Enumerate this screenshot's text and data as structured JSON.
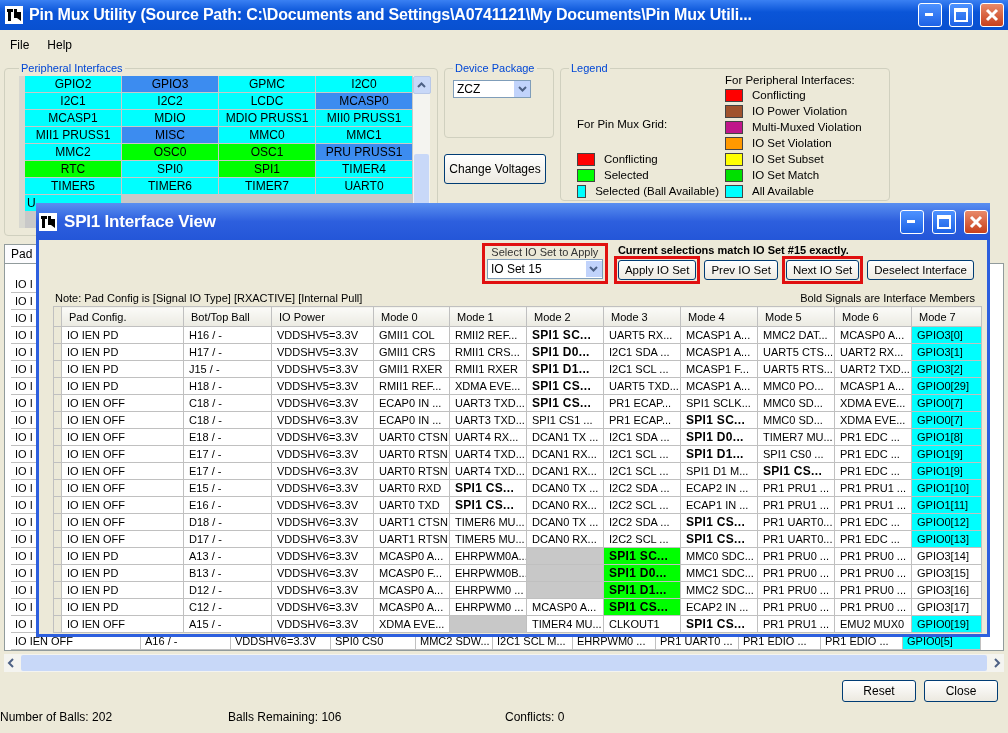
{
  "window": {
    "title": "Pin Mux Utility (Source Path: C:\\Documents and Settings\\A0741121\\My Documents\\Pin Mux Utili..."
  },
  "menu": [
    "File",
    "Help"
  ],
  "peripheral_interfaces": {
    "title": "Peripheral Interfaces",
    "rows": [
      [
        {
          "label": "GPIO2",
          "color": "#00ffff"
        },
        {
          "label": "GPIO3",
          "color": "#3c8cf0"
        },
        {
          "label": "GPMC",
          "color": "#00ffff"
        },
        {
          "label": "I2C0",
          "color": "#00ffff"
        }
      ],
      [
        {
          "label": "I2C1",
          "color": "#00ffff"
        },
        {
          "label": "I2C2",
          "color": "#00ffff"
        },
        {
          "label": "LCDC",
          "color": "#00ffff"
        },
        {
          "label": "MCASP0",
          "color": "#3c8cf0"
        }
      ],
      [
        {
          "label": "MCASP1",
          "color": "#00ffff"
        },
        {
          "label": "MDIO",
          "color": "#00ffff"
        },
        {
          "label": "MDIO PRUSS1",
          "color": "#00ffff"
        },
        {
          "label": "MII0 PRUSS1",
          "color": "#00ffff"
        }
      ],
      [
        {
          "label": "MII1 PRUSS1",
          "color": "#00ffff"
        },
        {
          "label": "MISC",
          "color": "#3c8cf0"
        },
        {
          "label": "MMC0",
          "color": "#00ffff"
        },
        {
          "label": "MMC1",
          "color": "#00ffff"
        }
      ],
      [
        {
          "label": "MMC2",
          "color": "#00ffff"
        },
        {
          "label": "OSC0",
          "color": "#00ff00"
        },
        {
          "label": "OSC1",
          "color": "#00ff00"
        },
        {
          "label": "PRU PRUSS1",
          "color": "#3c8cf0"
        }
      ],
      [
        {
          "label": "RTC",
          "color": "#00ff00"
        },
        {
          "label": "SPI0",
          "color": "#00ffff"
        },
        {
          "label": "SPI1",
          "color": "#00ff00"
        },
        {
          "label": "TIMER4",
          "color": "#00ffff"
        }
      ],
      [
        {
          "label": "TIMER5",
          "color": "#00ffff"
        },
        {
          "label": "TIMER6",
          "color": "#00ffff"
        },
        {
          "label": "TIMER7",
          "color": "#00ffff"
        },
        {
          "label": "UART0",
          "color": "#00ffff"
        }
      ],
      [
        {
          "label": "U",
          "color": "#00ffff"
        }
      ]
    ]
  },
  "device_package": {
    "title": "Device Package",
    "value": "ZCZ"
  },
  "change_voltages_button": "Change Voltages",
  "legend": {
    "title": "Legend",
    "grid_heading": "For Pin Mux Grid:",
    "grid_items": [
      {
        "label": "Conflicting",
        "color": "#ff0000"
      },
      {
        "label": "Selected",
        "color": "#00ff00"
      },
      {
        "label": "Selected (Ball Available)",
        "color": "#00ffff"
      }
    ],
    "peripheral_heading": "For Peripheral Interfaces:",
    "peripheral_items": [
      {
        "label": "Conflicting",
        "color": "#ff0000"
      },
      {
        "label": "IO Power Violation",
        "color": "#a0522d"
      },
      {
        "label": "Multi-Muxed Violation",
        "color": "#c0168a"
      },
      {
        "label": "IO Set Violation",
        "color": "#ff9900"
      },
      {
        "label": "IO Set Subset",
        "color": "#ffff00"
      },
      {
        "label": "IO Set Match",
        "color": "#00e000"
      },
      {
        "label": "All Available",
        "color": "#00ffff"
      }
    ]
  },
  "background_table": {
    "tab": "Pad",
    "rows": [
      "IO I",
      "IO I",
      "IO I",
      "IO I",
      "IO I",
      "IO I",
      "IO I",
      "IO I",
      "IO I",
      "IO I",
      "IO I",
      "IO I",
      "IO I",
      "IO I",
      "IO I",
      "IO I",
      "IO I",
      "IO I",
      "IO I",
      "IO I",
      "IO I"
    ],
    "last_row": [
      {
        "text": "IO IEN OFF",
        "kind": "plain"
      },
      {
        "text": "A16 / -",
        "kind": "plain"
      },
      {
        "text": "VDDSHV6=3.3V",
        "kind": "plain"
      },
      {
        "text": "SPI0 CS0",
        "kind": "plain"
      },
      {
        "text": "MMC2 SDW...",
        "kind": "plain"
      },
      {
        "text": "I2C1 SCL M...",
        "kind": "plain"
      },
      {
        "text": "EHRPWM0 ...",
        "kind": "plain"
      },
      {
        "text": "PR1 UART0 ...",
        "kind": "plain"
      },
      {
        "text": "PR1 EDIO ...",
        "kind": "plain"
      },
      {
        "text": "PR1 EDIO ...",
        "kind": "plain"
      },
      {
        "text": "GPIO0[5]",
        "kind": "available"
      }
    ]
  },
  "dialog": {
    "title": "SPI1 Interface View",
    "io_set_label": "Select IO Set to Apply",
    "io_set": {
      "value": "IO Set 15",
      "annotated": true
    },
    "message": "Current selections match IO Set #15 exactly.",
    "buttons": [
      {
        "label": "Apply IO Set",
        "annotated": true
      },
      {
        "label": "Prev IO Set",
        "annotated": false
      },
      {
        "label": "Next IO Set",
        "annotated": true
      },
      {
        "label": "Deselect Interface",
        "annotated": false
      }
    ],
    "note": "Note: Pad Config is [Signal IO Type] [RXACTIVE] [Internal Pull]",
    "bold_note": "Bold Signals are Interface Members",
    "columns": [
      "Pad Config.",
      "Bot/Top Ball",
      "IO Power",
      "Mode 0",
      "Mode 1",
      "Mode 2",
      "Mode 3",
      "Mode 4",
      "Mode 5",
      "Mode 6",
      "Mode 7"
    ],
    "rows": [
      {
        "pad": "IO IEN PD",
        "ball": "H16 / -",
        "power": "VDDSHV5=3.3V",
        "modes": [
          {
            "text": "GMII1 COL",
            "bold": false,
            "kind": "plain"
          },
          {
            "text": "RMII2 REF...",
            "bold": false,
            "kind": "plain"
          },
          {
            "text": "SPI1 SC...",
            "bold": true,
            "kind": "plain"
          },
          {
            "text": "UART5 RX...",
            "bold": false,
            "kind": "plain"
          },
          {
            "text": "MCASP1 A...",
            "bold": false,
            "kind": "plain"
          },
          {
            "text": "MMC2 DAT...",
            "bold": false,
            "kind": "plain"
          },
          {
            "text": "MCASP0 A...",
            "bold": false,
            "kind": "plain"
          },
          {
            "text": "GPIO3[0]",
            "bold": false,
            "kind": "available"
          }
        ]
      },
      {
        "pad": "IO IEN PD",
        "ball": "H17 / -",
        "power": "VDDSHV5=3.3V",
        "modes": [
          {
            "text": "GMII1 CRS",
            "bold": false,
            "kind": "plain"
          },
          {
            "text": "RMII1 CRS...",
            "bold": false,
            "kind": "plain"
          },
          {
            "text": "SPI1 D0...",
            "bold": true,
            "kind": "plain"
          },
          {
            "text": "I2C1 SDA ...",
            "bold": false,
            "kind": "plain"
          },
          {
            "text": "MCASP1 A...",
            "bold": false,
            "kind": "plain"
          },
          {
            "text": "UART5 CTS...",
            "bold": false,
            "kind": "plain"
          },
          {
            "text": "UART2 RX...",
            "bold": false,
            "kind": "plain"
          },
          {
            "text": "GPIO3[1]",
            "bold": false,
            "kind": "available"
          }
        ]
      },
      {
        "pad": "IO IEN PD",
        "ball": "J15 / -",
        "power": "VDDSHV5=3.3V",
        "modes": [
          {
            "text": "GMII1 RXER",
            "bold": false,
            "kind": "plain"
          },
          {
            "text": "RMII1 RXER",
            "bold": false,
            "kind": "plain"
          },
          {
            "text": "SPI1 D1...",
            "bold": true,
            "kind": "plain"
          },
          {
            "text": "I2C1 SCL ...",
            "bold": false,
            "kind": "plain"
          },
          {
            "text": "MCASP1 F...",
            "bold": false,
            "kind": "plain"
          },
          {
            "text": "UART5 RTS...",
            "bold": false,
            "kind": "plain"
          },
          {
            "text": "UART2 TXD...",
            "bold": false,
            "kind": "plain"
          },
          {
            "text": "GPIO3[2]",
            "bold": false,
            "kind": "available"
          }
        ]
      },
      {
        "pad": "IO IEN PD",
        "ball": "H18 / -",
        "power": "VDDSHV5=3.3V",
        "modes": [
          {
            "text": "RMII1 REF...",
            "bold": false,
            "kind": "plain"
          },
          {
            "text": "XDMA EVE...",
            "bold": false,
            "kind": "plain"
          },
          {
            "text": "SPI1 CS...",
            "bold": true,
            "kind": "plain"
          },
          {
            "text": "UART5 TXD...",
            "bold": false,
            "kind": "plain"
          },
          {
            "text": "MCASP1 A...",
            "bold": false,
            "kind": "plain"
          },
          {
            "text": "MMC0 PO...",
            "bold": false,
            "kind": "plain"
          },
          {
            "text": "MCASP1 A...",
            "bold": false,
            "kind": "plain"
          },
          {
            "text": "GPIO0[29]",
            "bold": false,
            "kind": "available"
          }
        ]
      },
      {
        "pad": "IO IEN OFF",
        "ball": "C18 / -",
        "power": "VDDSHV6=3.3V",
        "modes": [
          {
            "text": "ECAP0 IN ...",
            "bold": false,
            "kind": "plain"
          },
          {
            "text": "UART3 TXD...",
            "bold": false,
            "kind": "plain"
          },
          {
            "text": "SPI1 CS...",
            "bold": true,
            "kind": "plain"
          },
          {
            "text": "PR1 ECAP...",
            "bold": false,
            "kind": "plain"
          },
          {
            "text": "SPI1 SCLK...",
            "bold": false,
            "kind": "plain"
          },
          {
            "text": "MMC0 SD...",
            "bold": false,
            "kind": "plain"
          },
          {
            "text": "XDMA EVE...",
            "bold": false,
            "kind": "plain"
          },
          {
            "text": "GPIO0[7]",
            "bold": false,
            "kind": "available"
          }
        ]
      },
      {
        "pad": "IO IEN OFF",
        "ball": "C18 / -",
        "power": "VDDSHV6=3.3V",
        "modes": [
          {
            "text": "ECAP0 IN ...",
            "bold": false,
            "kind": "plain"
          },
          {
            "text": "UART3 TXD...",
            "bold": false,
            "kind": "plain"
          },
          {
            "text": "SPI1 CS1 ...",
            "bold": false,
            "kind": "plain"
          },
          {
            "text": "PR1 ECAP...",
            "bold": false,
            "kind": "plain"
          },
          {
            "text": "SPI1 SC...",
            "bold": true,
            "kind": "plain"
          },
          {
            "text": "MMC0 SD...",
            "bold": false,
            "kind": "plain"
          },
          {
            "text": "XDMA EVE...",
            "bold": false,
            "kind": "plain"
          },
          {
            "text": "GPIO0[7]",
            "bold": false,
            "kind": "available"
          }
        ]
      },
      {
        "pad": "IO IEN OFF",
        "ball": "E18 / -",
        "power": "VDDSHV6=3.3V",
        "modes": [
          {
            "text": "UART0 CTSN",
            "bold": false,
            "kind": "plain"
          },
          {
            "text": "UART4 RX...",
            "bold": false,
            "kind": "plain"
          },
          {
            "text": "DCAN1 TX ...",
            "bold": false,
            "kind": "plain"
          },
          {
            "text": "I2C1 SDA ...",
            "bold": false,
            "kind": "plain"
          },
          {
            "text": "SPI1 D0...",
            "bold": true,
            "kind": "plain"
          },
          {
            "text": "TIMER7 MU...",
            "bold": false,
            "kind": "plain"
          },
          {
            "text": "PR1 EDC ...",
            "bold": false,
            "kind": "plain"
          },
          {
            "text": "GPIO1[8]",
            "bold": false,
            "kind": "available"
          }
        ]
      },
      {
        "pad": "IO IEN OFF",
        "ball": "E17 / -",
        "power": "VDDSHV6=3.3V",
        "modes": [
          {
            "text": "UART0 RTSN",
            "bold": false,
            "kind": "plain"
          },
          {
            "text": "UART4 TXD...",
            "bold": false,
            "kind": "plain"
          },
          {
            "text": "DCAN1 RX...",
            "bold": false,
            "kind": "plain"
          },
          {
            "text": "I2C1 SCL ...",
            "bold": false,
            "kind": "plain"
          },
          {
            "text": "SPI1 D1...",
            "bold": true,
            "kind": "plain"
          },
          {
            "text": "SPI1 CS0 ...",
            "bold": false,
            "kind": "plain"
          },
          {
            "text": "PR1 EDC ...",
            "bold": false,
            "kind": "plain"
          },
          {
            "text": "GPIO1[9]",
            "bold": false,
            "kind": "available"
          }
        ]
      },
      {
        "pad": "IO IEN OFF",
        "ball": "E17 / -",
        "power": "VDDSHV6=3.3V",
        "modes": [
          {
            "text": "UART0 RTSN",
            "bold": false,
            "kind": "plain"
          },
          {
            "text": "UART4 TXD...",
            "bold": false,
            "kind": "plain"
          },
          {
            "text": "DCAN1 RX...",
            "bold": false,
            "kind": "plain"
          },
          {
            "text": "I2C1 SCL ...",
            "bold": false,
            "kind": "plain"
          },
          {
            "text": "SPI1 D1 M...",
            "bold": false,
            "kind": "plain"
          },
          {
            "text": "SPI1 CS...",
            "bold": true,
            "kind": "plain"
          },
          {
            "text": "PR1 EDC ...",
            "bold": false,
            "kind": "plain"
          },
          {
            "text": "GPIO1[9]",
            "bold": false,
            "kind": "available"
          }
        ]
      },
      {
        "pad": "IO IEN OFF",
        "ball": "E15 / -",
        "power": "VDDSHV6=3.3V",
        "modes": [
          {
            "text": "UART0 RXD",
            "bold": false,
            "kind": "plain"
          },
          {
            "text": "SPI1 CS...",
            "bold": true,
            "kind": "plain"
          },
          {
            "text": "DCAN0 TX ...",
            "bold": false,
            "kind": "plain"
          },
          {
            "text": "I2C2 SDA ...",
            "bold": false,
            "kind": "plain"
          },
          {
            "text": "ECAP2 IN ...",
            "bold": false,
            "kind": "plain"
          },
          {
            "text": "PR1 PRU1 ...",
            "bold": false,
            "kind": "plain"
          },
          {
            "text": "PR1 PRU1 ...",
            "bold": false,
            "kind": "plain"
          },
          {
            "text": "GPIO1[10]",
            "bold": false,
            "kind": "available"
          }
        ]
      },
      {
        "pad": "IO IEN OFF",
        "ball": "E16 / -",
        "power": "VDDSHV6=3.3V",
        "modes": [
          {
            "text": "UART0 TXD",
            "bold": false,
            "kind": "plain"
          },
          {
            "text": "SPI1 CS...",
            "bold": true,
            "kind": "plain"
          },
          {
            "text": "DCAN0 RX...",
            "bold": false,
            "kind": "plain"
          },
          {
            "text": "I2C2 SCL ...",
            "bold": false,
            "kind": "plain"
          },
          {
            "text": "ECAP1 IN ...",
            "bold": false,
            "kind": "plain"
          },
          {
            "text": "PR1 PRU1 ...",
            "bold": false,
            "kind": "plain"
          },
          {
            "text": "PR1 PRU1 ...",
            "bold": false,
            "kind": "plain"
          },
          {
            "text": "GPIO1[11]",
            "bold": false,
            "kind": "available"
          }
        ]
      },
      {
        "pad": "IO IEN OFF",
        "ball": "D18 / -",
        "power": "VDDSHV6=3.3V",
        "modes": [
          {
            "text": "UART1 CTSN",
            "bold": false,
            "kind": "plain"
          },
          {
            "text": "TIMER6 MU...",
            "bold": false,
            "kind": "plain"
          },
          {
            "text": "DCAN0 TX ...",
            "bold": false,
            "kind": "plain"
          },
          {
            "text": "I2C2 SDA ...",
            "bold": false,
            "kind": "plain"
          },
          {
            "text": "SPI1 CS...",
            "bold": true,
            "kind": "plain"
          },
          {
            "text": "PR1 UART0...",
            "bold": false,
            "kind": "plain"
          },
          {
            "text": "PR1 EDC ...",
            "bold": false,
            "kind": "plain"
          },
          {
            "text": "GPIO0[12]",
            "bold": false,
            "kind": "available"
          }
        ]
      },
      {
        "pad": "IO IEN OFF",
        "ball": "D17 / -",
        "power": "VDDSHV6=3.3V",
        "modes": [
          {
            "text": "UART1 RTSN",
            "bold": false,
            "kind": "plain"
          },
          {
            "text": "TIMER5 MU...",
            "bold": false,
            "kind": "plain"
          },
          {
            "text": "DCAN0 RX...",
            "bold": false,
            "kind": "plain"
          },
          {
            "text": "I2C2 SCL ...",
            "bold": false,
            "kind": "plain"
          },
          {
            "text": "SPI1 CS...",
            "bold": true,
            "kind": "plain"
          },
          {
            "text": "PR1 UART0...",
            "bold": false,
            "kind": "plain"
          },
          {
            "text": "PR1 EDC ...",
            "bold": false,
            "kind": "plain"
          },
          {
            "text": "GPIO0[13]",
            "bold": false,
            "kind": "available"
          }
        ]
      },
      {
        "pad": "IO IEN PD",
        "ball": "A13 / -",
        "power": "VDDSHV6=3.3V",
        "modes": [
          {
            "text": "MCASP0 A...",
            "bold": false,
            "kind": "plain"
          },
          {
            "text": "EHRPWM0A...",
            "bold": false,
            "kind": "plain"
          },
          {
            "kind": "empty"
          },
          {
            "text": "SPI1 SC...",
            "bold": true,
            "kind": "selected"
          },
          {
            "text": "MMC0 SDC...",
            "bold": false,
            "kind": "plain"
          },
          {
            "text": "PR1 PRU0 ...",
            "bold": false,
            "kind": "plain"
          },
          {
            "text": "PR1 PRU0 ...",
            "bold": false,
            "kind": "plain"
          },
          {
            "text": "GPIO3[14]",
            "bold": false,
            "kind": "plain"
          }
        ]
      },
      {
        "pad": "IO IEN PD",
        "ball": "B13 / -",
        "power": "VDDSHV6=3.3V",
        "modes": [
          {
            "text": "MCASP0 F...",
            "bold": false,
            "kind": "plain"
          },
          {
            "text": "EHRPWM0B...",
            "bold": false,
            "kind": "plain"
          },
          {
            "kind": "empty"
          },
          {
            "text": "SPI1 D0...",
            "bold": true,
            "kind": "selected"
          },
          {
            "text": "MMC1 SDC...",
            "bold": false,
            "kind": "plain"
          },
          {
            "text": "PR1 PRU0 ...",
            "bold": false,
            "kind": "plain"
          },
          {
            "text": "PR1 PRU0 ...",
            "bold": false,
            "kind": "plain"
          },
          {
            "text": "GPIO3[15]",
            "bold": false,
            "kind": "plain"
          }
        ]
      },
      {
        "pad": "IO IEN PD",
        "ball": "D12 / -",
        "power": "VDDSHV6=3.3V",
        "modes": [
          {
            "text": "MCASP0 A...",
            "bold": false,
            "kind": "plain"
          },
          {
            "text": "EHRPWM0 ...",
            "bold": false,
            "kind": "plain"
          },
          {
            "kind": "empty"
          },
          {
            "text": "SPI1 D1...",
            "bold": true,
            "kind": "selected"
          },
          {
            "text": "MMC2 SDC...",
            "bold": false,
            "kind": "plain"
          },
          {
            "text": "PR1 PRU0 ...",
            "bold": false,
            "kind": "plain"
          },
          {
            "text": "PR1 PRU0 ...",
            "bold": false,
            "kind": "plain"
          },
          {
            "text": "GPIO3[16]",
            "bold": false,
            "kind": "plain"
          }
        ]
      },
      {
        "pad": "IO IEN PD",
        "ball": "C12 / -",
        "power": "VDDSHV6=3.3V",
        "modes": [
          {
            "text": "MCASP0 A...",
            "bold": false,
            "kind": "plain"
          },
          {
            "text": "EHRPWM0 ...",
            "bold": false,
            "kind": "plain"
          },
          {
            "text": "MCASP0 A...",
            "bold": false,
            "kind": "plain"
          },
          {
            "text": "SPI1 CS...",
            "bold": true,
            "kind": "selected"
          },
          {
            "text": "ECAP2 IN ...",
            "bold": false,
            "kind": "plain"
          },
          {
            "text": "PR1 PRU0 ...",
            "bold": false,
            "kind": "plain"
          },
          {
            "text": "PR1 PRU0 ...",
            "bold": false,
            "kind": "plain"
          },
          {
            "text": "GPIO3[17]",
            "bold": false,
            "kind": "plain"
          }
        ]
      },
      {
        "pad": "IO IEN OFF",
        "ball": "A15 / -",
        "power": "VDDSHV6=3.3V",
        "modes": [
          {
            "text": "XDMA EVE...",
            "bold": false,
            "kind": "plain"
          },
          {
            "kind": "empty"
          },
          {
            "text": "TIMER4 MU...",
            "bold": false,
            "kind": "plain"
          },
          {
            "text": "CLKOUT1",
            "bold": false,
            "kind": "plain"
          },
          {
            "text": "SPI1 CS...",
            "bold": true,
            "kind": "plain"
          },
          {
            "text": "PR1 PRU1 ...",
            "bold": false,
            "kind": "plain"
          },
          {
            "text": "EMU2 MUX0",
            "bold": false,
            "kind": "plain"
          },
          {
            "text": "GPIO0[19]",
            "bold": false,
            "kind": "available"
          }
        ]
      }
    ]
  },
  "buttons": [
    "Reset",
    "Close"
  ],
  "status_bar": [
    "Number of Balls: 202",
    "Balls Remaining: 106",
    "Conflicts: 0"
  ]
}
